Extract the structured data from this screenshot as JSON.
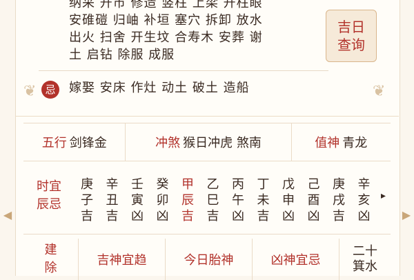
{
  "yi": {
    "lines": [
      "纳采 开市 修造 竖柱 上梁 开柱眼",
      "安碓磑 归岫 补垣 塞穴 拆卸 放水",
      "出火 扫舍 开生坟 合寿木 安葬 谢",
      "土 启钻 除服 成服"
    ]
  },
  "jiri_button": {
    "line1": "吉日",
    "line2": "查询"
  },
  "ji": {
    "badge": "忌",
    "text": "嫁娶 安床 作灶 动土 破土 造船"
  },
  "info": {
    "wuxing_label": "五行",
    "wuxing_value": "剑锋金",
    "chongsha_label": "冲煞",
    "chongsha_value": "猴日冲虎 煞南",
    "zhishen_label": "值神",
    "zhishen_value": "青龙"
  },
  "hours": {
    "label_line1": "时宜",
    "label_line2": "辰忌",
    "columns": [
      {
        "top": "庚",
        "mid": "子",
        "bot": "吉"
      },
      {
        "top": "辛",
        "mid": "丑",
        "bot": "吉"
      },
      {
        "top": "壬",
        "mid": "寅",
        "bot": "凶"
      },
      {
        "top": "癸",
        "mid": "卯",
        "bot": "凶"
      },
      {
        "top": "甲",
        "mid": "辰",
        "bot": "吉"
      },
      {
        "top": "乙",
        "mid": "巳",
        "bot": "吉"
      },
      {
        "top": "丙",
        "mid": "午",
        "bot": "凶"
      },
      {
        "top": "丁",
        "mid": "未",
        "bot": "吉"
      },
      {
        "top": "戊",
        "mid": "申",
        "bot": "凶"
      },
      {
        "top": "己",
        "mid": "酉",
        "bot": "凶"
      },
      {
        "top": "庚",
        "mid": "戌",
        "bot": "吉"
      },
      {
        "top": "辛",
        "mid": "亥",
        "bot": "凶"
      }
    ],
    "highlight_index": 4,
    "next_arrow": "▸"
  },
  "bottom": {
    "jianchu_line1": "建",
    "jianchu_line2": "除",
    "jishen": "吉神宜趋",
    "taishen": "今日胎神",
    "xiongshen": "凶神宜忌",
    "xingxiu_line1": "二十",
    "xingxiu_line2": "箕水"
  },
  "nav": {
    "prev": "◀",
    "next": "▶"
  },
  "colors": {
    "accent_red": "#b2322b",
    "gold": "#d9b58b",
    "bg": "#fbf6ee"
  }
}
